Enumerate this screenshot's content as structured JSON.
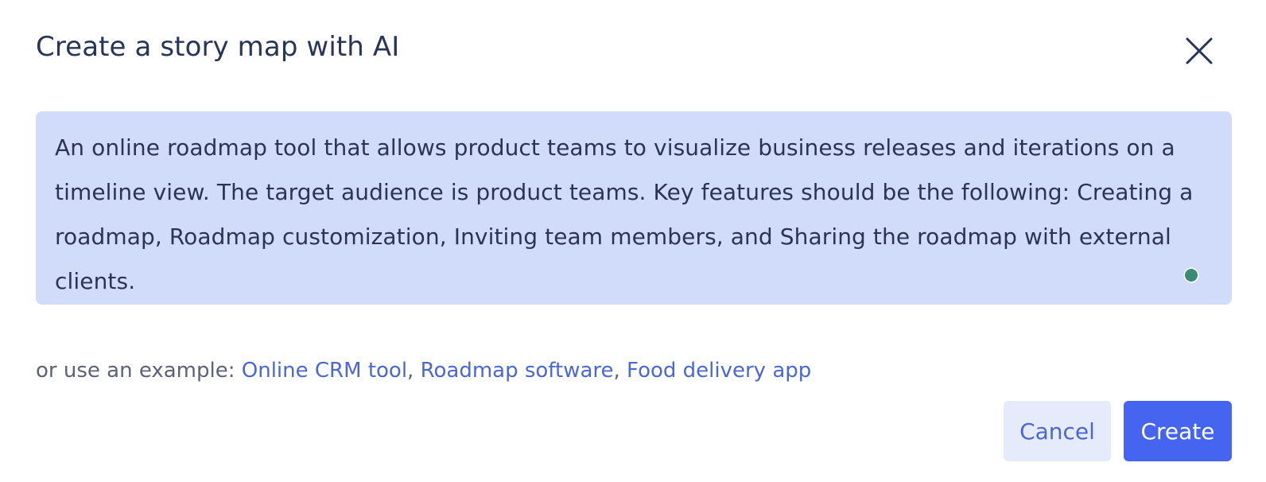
{
  "dialog": {
    "title": "Create a story map with AI",
    "close_icon": "close-icon"
  },
  "prompt": {
    "text": "An online roadmap tool that allows product teams to visualize business releases and iterations on a timeline view. The target audience is product teams. Key features should be the following: Creating a roadmap, Roadmap customization, Inviting team members, and Sharing the roadmap with external clients."
  },
  "examples": {
    "lead": "or use an example:",
    "items": [
      "Online CRM tool",
      "Roadmap software",
      "Food delivery app"
    ],
    "separator": ","
  },
  "actions": {
    "cancel_label": "Cancel",
    "create_label": "Create"
  },
  "colors": {
    "prompt_background": "#d1dbfa",
    "link": "#4a67d4",
    "primary_button": "#4565f0",
    "secondary_button": "#e6ebfb",
    "status_dot": "#3b8a76"
  }
}
